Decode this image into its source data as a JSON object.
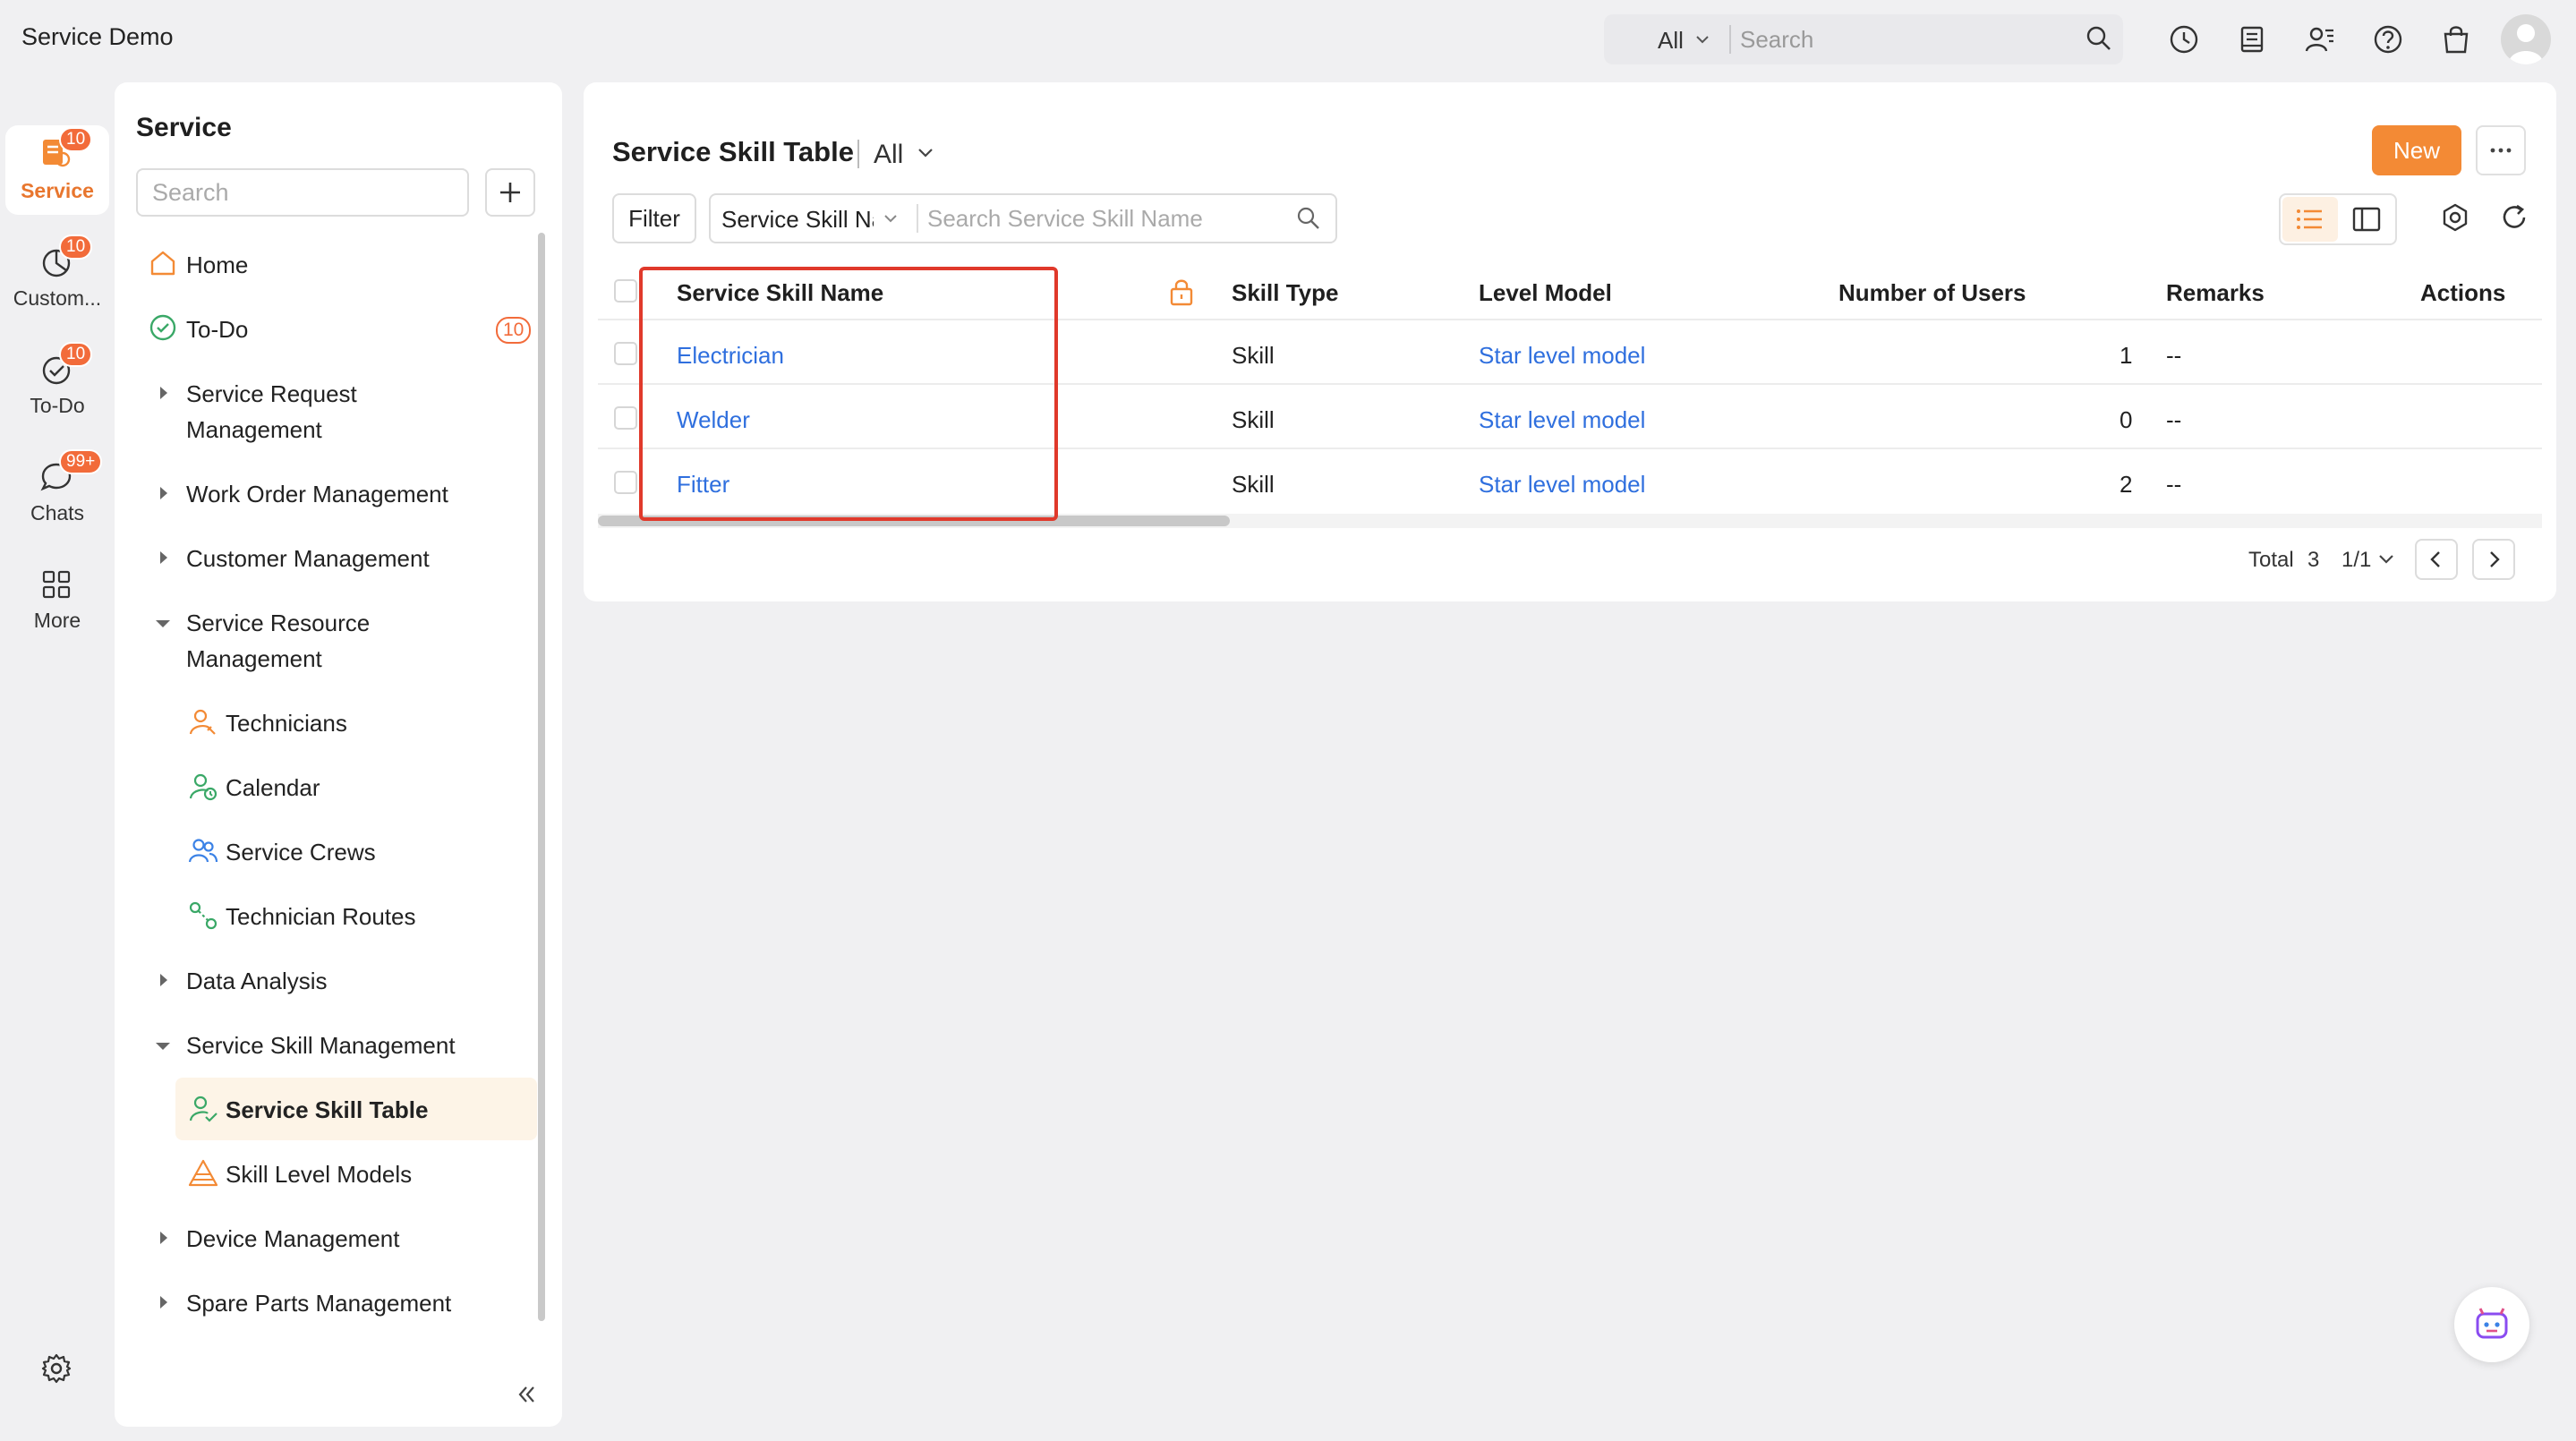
{
  "app": {
    "title": "Service Demo"
  },
  "global_search": {
    "scope": "All",
    "placeholder": "Search"
  },
  "rail": {
    "items": [
      {
        "label": "Service",
        "badge": "10",
        "icon": "service-icon",
        "active": true
      },
      {
        "label": "Custom...",
        "badge": "10",
        "icon": "pie-chart-icon"
      },
      {
        "label": "To-Do",
        "badge": "10",
        "icon": "todo-check-icon"
      },
      {
        "label": "Chats",
        "badge": "99+",
        "icon": "chat-bubble-icon"
      },
      {
        "label": "More",
        "icon": "grid-icon"
      }
    ]
  },
  "sidebar": {
    "title": "Service",
    "search_placeholder": "Search",
    "items": [
      {
        "label": "Home"
      },
      {
        "label": "To-Do",
        "badge": "10"
      },
      {
        "label_line1": "Service Request",
        "label_line2": "Management"
      },
      {
        "label": "Work Order Management"
      },
      {
        "label": "Customer Management"
      },
      {
        "label_line1": "Service Resource",
        "label_line2": "Management"
      },
      {
        "label": "Technicians"
      },
      {
        "label": "Calendar"
      },
      {
        "label": "Service Crews"
      },
      {
        "label": "Technician Routes"
      },
      {
        "label": "Data Analysis"
      },
      {
        "label": "Service Skill Management"
      },
      {
        "label": "Service Skill Table"
      },
      {
        "label": "Skill Level Models"
      },
      {
        "label": "Device Management"
      },
      {
        "label": "Spare Parts Management"
      }
    ]
  },
  "main": {
    "title": "Service Skill Table",
    "view": "All",
    "new_label": "New",
    "filter_label": "Filter",
    "search_field": "Service Skill Name",
    "search_placeholder": "Search Service Skill Name",
    "columns": [
      "Service Skill Name",
      "Skill Type",
      "Level Model",
      "Number of Users",
      "Remarks",
      "Actions"
    ],
    "rows": [
      {
        "name": "Electrician",
        "type": "Skill",
        "level_model": "Star level model",
        "users": "1",
        "remarks": "--"
      },
      {
        "name": "Welder",
        "type": "Skill",
        "level_model": "Star level model",
        "users": "0",
        "remarks": "--"
      },
      {
        "name": "Fitter",
        "type": "Skill",
        "level_model": "Star level model",
        "users": "2",
        "remarks": "--"
      }
    ],
    "pager": {
      "total_label": "Total",
      "total": "3",
      "page": "1/1"
    }
  },
  "colors": {
    "accent": "#f38a35",
    "link": "#2f6fde",
    "badge": "#f26b3a",
    "highlight": "#e0392b"
  }
}
